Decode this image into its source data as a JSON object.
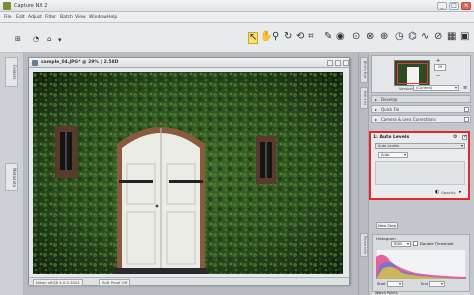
{
  "app": {
    "title": "Capture NX 2",
    "window_buttons": [
      "_",
      "□",
      "×"
    ]
  },
  "menu": [
    "File",
    "Edit",
    "Adjust",
    "Filter",
    "Batch",
    "View",
    "Window",
    "Help"
  ],
  "toolbar": {
    "tools": [
      "arrow-tool",
      "hand-tool",
      "zoom-tool",
      "rotate-tool",
      "straighten-tool",
      "crop-tool",
      "retouch-tool",
      "red-eye-tool",
      "control-point-tool",
      "selection-tool",
      "lasso-tool",
      "fill-tool",
      "brush-tool"
    ],
    "left_tools": [
      "browse-tool",
      "history-tool"
    ]
  },
  "left_strip": {
    "tabs": [
      "Folders",
      "Metadata"
    ]
  },
  "document": {
    "title": "sample_04.JPG* @ 29% | 2.58D",
    "status_left": "Nikon sRGB 4.0.0.3001",
    "status_right": "Soft Proof Off"
  },
  "right_panel": {
    "tabs": [
      "Bird's Eye",
      "Edit List",
      "Photo Info"
    ],
    "zoom_value": "29",
    "version_label": "Version",
    "version_value": "(Current)",
    "sections": {
      "develop": "Develop",
      "quick_fix": "Quick Fix",
      "camera_lens": "Camera & Lens Corrections"
    },
    "auto_levels": {
      "header": "1: Auto Levels",
      "dropdown_1": "Auto Levels",
      "dropdown_2": "Auto",
      "opacity_label": "Opacity"
    },
    "new_step": "New Step",
    "histogram": {
      "label": "Histogram",
      "channel": "RGB",
      "double_threshold": "Double Threshold",
      "start": "Start",
      "end": "End"
    },
    "watch_points": "Watch Points"
  },
  "colors": {
    "accent_highlight": "#e0272b",
    "tool_selected": "#f6e36c"
  }
}
